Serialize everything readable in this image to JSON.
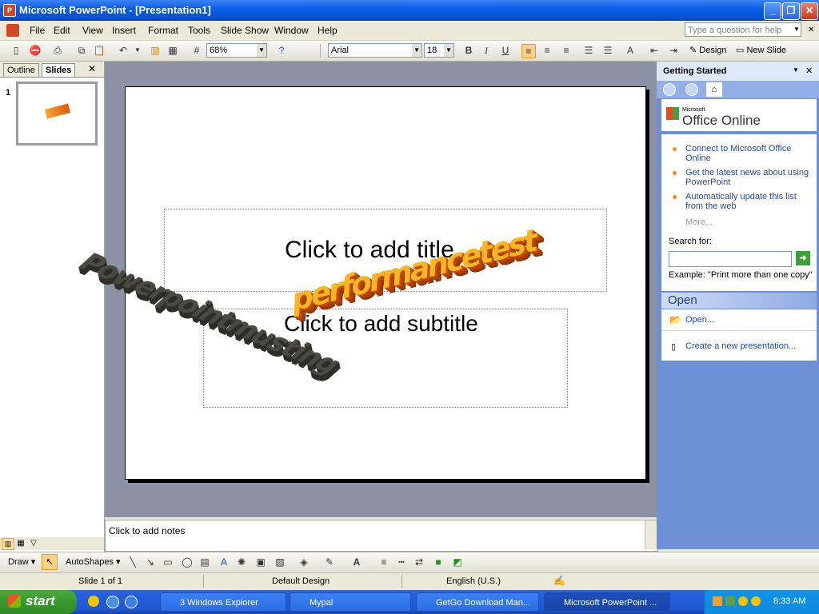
{
  "window": {
    "title": "Microsoft PowerPoint - [Presentation1]"
  },
  "menu": [
    "File",
    "Edit",
    "View",
    "Insert",
    "Format",
    "Tools",
    "Slide Show",
    "Window",
    "Help"
  ],
  "help_box": {
    "placeholder": "Type a question for help"
  },
  "toolbar": {
    "zoom": "68%",
    "font": "Arial",
    "font_size": "18",
    "bold": "B",
    "italic": "I",
    "underline": "U",
    "design_label": "Design",
    "new_slide_label": "New Slide"
  },
  "left_pane": {
    "tabs": [
      "Outline",
      "Slides"
    ],
    "slide_number": "1"
  },
  "slide": {
    "title_placeholder": "Click to add title",
    "subtitle_placeholder": "Click to add subtitle",
    "wordart_1": "Powerpointmusting ",
    "wordart_2": "performancetest"
  },
  "notes": {
    "placeholder": "Click to add notes"
  },
  "task_pane": {
    "title": "Getting Started",
    "logo_small": "Microsoft",
    "logo": "Office Online",
    "links": [
      "Connect to Microsoft Office Online",
      "Get the latest news about using PowerPoint",
      "Automatically update this list from the web"
    ],
    "more": "More...",
    "search_label": "Search for:",
    "example": "Example:  \"Print more than one copy\"",
    "open_header": "Open",
    "open_link": "Open...",
    "create_link": "Create a new presentation..."
  },
  "drawbar": {
    "draw": "Draw",
    "autoshapes": "AutoShapes"
  },
  "status": {
    "slide": "Slide 1 of 1",
    "design": "Default Design",
    "language": "English (U.S.)"
  },
  "taskbar": {
    "start": "start",
    "tasks": [
      "3 Windows Explorer",
      "Mypal",
      "GetGo Download Man...",
      "Microsoft PowerPoint ..."
    ],
    "clock": "8:33 AM"
  },
  "colors": {
    "taskpane_bg": "#6f8fd6",
    "link": "#2149aa",
    "bullet": "#f28e1e"
  }
}
